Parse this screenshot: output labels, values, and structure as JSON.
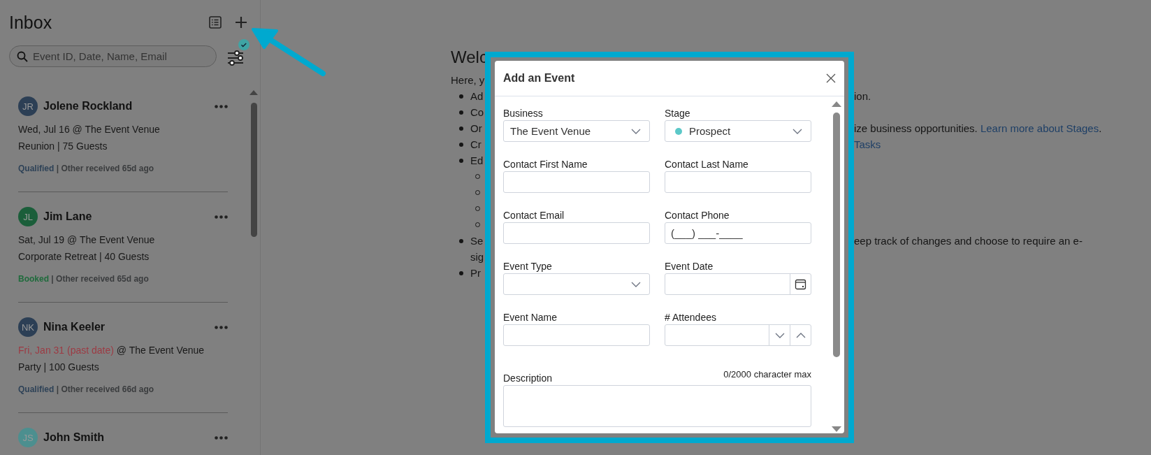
{
  "sidebar": {
    "title": "Inbox",
    "search": {
      "placeholder": "Event ID, Date, Name, Email"
    },
    "cards": [
      {
        "initials": "JR",
        "color": "#2c3f55",
        "name": "Jolene Rockland",
        "date": "Wed, Jul 16",
        "past_date": false,
        "venue": "@ The Event Venue",
        "details": "Reunion | 75 Guests",
        "status": {
          "label": "Qualified",
          "color": "#2e4257"
        },
        "received": "| Other received 65d ago"
      },
      {
        "initials": "JL",
        "color": "#1b5e3a",
        "name": "Jim Lane",
        "date": "Sat, Jul 19",
        "past_date": false,
        "venue": "@ The Event Venue",
        "details": "Corporate Retreat | 40 Guests",
        "status": {
          "label": "Booked",
          "color": "#1f6b3c"
        },
        "received": "| Other received 65d ago"
      },
      {
        "initials": "NK",
        "color": "#2c3f55",
        "name": "Nina Keeler",
        "date": "Fri, Jan 31 (past date)",
        "past_date": true,
        "venue": "@ The Event Venue",
        "details": "Party | 100 Guests",
        "status": {
          "label": "Qualified",
          "color": "#2e4257"
        },
        "received": "| Other received 66d ago"
      },
      {
        "initials": "JS",
        "color": "#4c8f8f",
        "name": "John Smith"
      }
    ]
  },
  "welcome": {
    "heading": "Welc",
    "lines": [
      {
        "kind": "text",
        "left": "Here, y"
      },
      {
        "kind": "bullet",
        "left": "Ad",
        "right": "ion."
      },
      {
        "kind": "bullet",
        "left": "Co"
      },
      {
        "kind": "bullet",
        "left": "Or",
        "right": "ize business opportunities. ",
        "link": "Learn more about Stages",
        "after": "."
      },
      {
        "kind": "bullet",
        "left": "Cr",
        "link": "Tasks"
      },
      {
        "kind": "bullet",
        "left": "Ed"
      },
      {
        "kind": "sub"
      },
      {
        "kind": "sub"
      },
      {
        "kind": "sub"
      },
      {
        "kind": "sub"
      },
      {
        "kind": "bullet",
        "left": "Se",
        "right": "eep track of changes and choose to require an e-"
      },
      {
        "kind": "text_indent",
        "left": "sig"
      },
      {
        "kind": "bullet",
        "left": "Pr"
      }
    ]
  },
  "modal": {
    "title": "Add an Event",
    "fields": [
      {
        "kind": "select",
        "label": "Business",
        "value": "The Event Venue"
      },
      {
        "kind": "select",
        "label": "Stage",
        "value": "Prospect",
        "color": "#5cc8c8"
      },
      {
        "kind": "text",
        "label": "Contact First Name"
      },
      {
        "kind": "text",
        "label": "Contact Last Name"
      },
      {
        "kind": "text",
        "label": "Contact Email"
      },
      {
        "kind": "text",
        "label": "Contact Phone",
        "value": "(___) ___-____"
      },
      {
        "kind": "select",
        "label": "Event Type"
      },
      {
        "kind": "date",
        "label": "Event Date"
      },
      {
        "kind": "text",
        "label": "Event Name"
      },
      {
        "kind": "number",
        "label": "# Attendees"
      }
    ],
    "description": {
      "label": "Description",
      "counter": "0/2000 character max"
    }
  }
}
